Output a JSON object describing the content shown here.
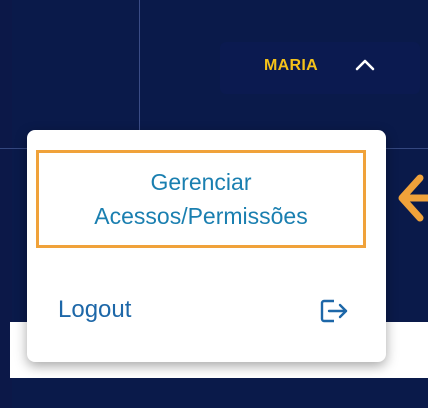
{
  "header": {
    "user_name": "MARIA",
    "user_menu_icon": "chevron-up-icon"
  },
  "dropdown": {
    "items": [
      {
        "label_line1": "Gerenciar",
        "label_line2": "Acessos/Permissões"
      },
      {
        "label": "Logout",
        "icon": "logout-icon"
      }
    ]
  },
  "annotation": {
    "icon": "left-arrow-icon",
    "highlight_color": "#f0a23a"
  },
  "colors": {
    "background": "#0a1a4a",
    "user_name": "#f4c21a",
    "link": "#1a7fb0"
  }
}
